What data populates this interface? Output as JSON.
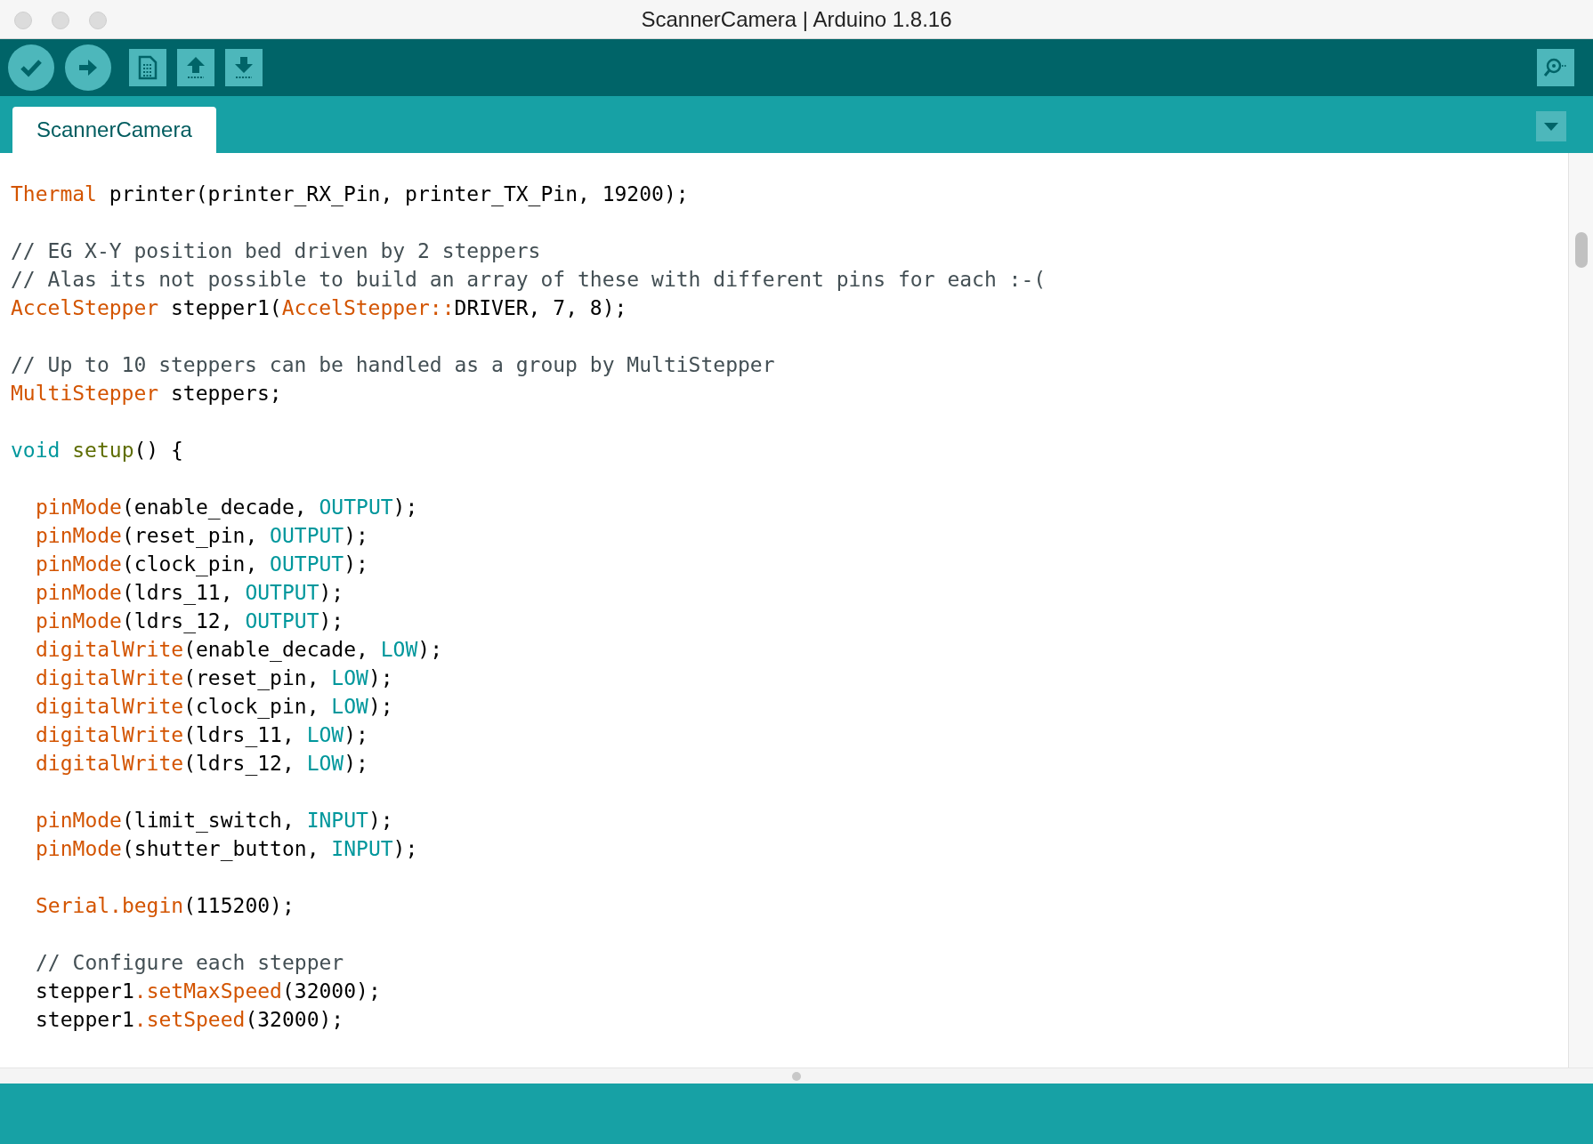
{
  "window": {
    "title": "ScannerCamera | Arduino 1.8.16"
  },
  "toolbar": {
    "buttons": [
      {
        "kind": "verify"
      },
      {
        "kind": "upload"
      },
      {
        "kind": "new"
      },
      {
        "kind": "open"
      },
      {
        "kind": "save"
      }
    ],
    "right_button": {
      "kind": "serial"
    }
  },
  "tabs": [
    {
      "label": "ScannerCamera",
      "selected": true
    }
  ],
  "editor": {
    "blocks": [
      {
        "lines": [
          {
            "tokens": [
              {
                "t": "Thermal",
                "kind": "type"
              },
              {
                "t": " printer(printer_RX_Pin, printer_TX_Pin, 19200);",
                "kind": "plain"
              }
            ]
          }
        ]
      },
      {
        "lines": [
          {
            "tokens": [
              {
                "t": "// EG X-Y position bed driven by 2 steppers",
                "kind": "comment"
              }
            ]
          },
          {
            "tokens": [
              {
                "t": "// Alas its not possible to build an array of these with different pins for each :-(",
                "kind": "comment"
              }
            ]
          },
          {
            "tokens": [
              {
                "t": "AccelStepper",
                "kind": "type"
              },
              {
                "t": " stepper1(",
                "kind": "plain"
              },
              {
                "t": "AccelStepper::",
                "kind": "type"
              },
              {
                "t": "DRIVER, 7, 8);",
                "kind": "plain"
              }
            ]
          }
        ]
      },
      {
        "lines": [
          {
            "tokens": [
              {
                "t": "// Up to 10 steppers can be handled as a group by MultiStepper",
                "kind": "comment"
              }
            ]
          },
          {
            "tokens": [
              {
                "t": "MultiStepper",
                "kind": "type"
              },
              {
                "t": " steppers;",
                "kind": "plain"
              }
            ]
          }
        ]
      },
      {
        "lines": [
          {
            "tokens": [
              {
                "t": "void",
                "kind": "keyword"
              },
              {
                "t": " setup",
                "kind": "decl"
              },
              {
                "t": "() {",
                "kind": "plain"
              }
            ],
            "children": [
              {
                "lines": [
                  {
                    "tokens": [
                      {
                        "t": "pinMode",
                        "kind": "type"
                      },
                      {
                        "t": "(enable_decade, ",
                        "kind": "plain"
                      },
                      {
                        "t": "OUTPUT",
                        "kind": "keyword"
                      },
                      {
                        "t": ");",
                        "kind": "plain"
                      }
                    ]
                  },
                  {
                    "tokens": [
                      {
                        "t": "pinMode",
                        "kind": "type"
                      },
                      {
                        "t": "(reset_pin, ",
                        "kind": "plain"
                      },
                      {
                        "t": "OUTPUT",
                        "kind": "keyword"
                      },
                      {
                        "t": ");",
                        "kind": "plain"
                      }
                    ]
                  },
                  {
                    "tokens": [
                      {
                        "t": "pinMode",
                        "kind": "type"
                      },
                      {
                        "t": "(clock_pin, ",
                        "kind": "plain"
                      },
                      {
                        "t": "OUTPUT",
                        "kind": "keyword"
                      },
                      {
                        "t": ");",
                        "kind": "plain"
                      }
                    ]
                  },
                  {
                    "tokens": [
                      {
                        "t": "pinMode",
                        "kind": "type"
                      },
                      {
                        "t": "(ldrs_11, ",
                        "kind": "plain"
                      },
                      {
                        "t": "OUTPUT",
                        "kind": "keyword"
                      },
                      {
                        "t": ");",
                        "kind": "plain"
                      }
                    ]
                  },
                  {
                    "tokens": [
                      {
                        "t": "pinMode",
                        "kind": "type"
                      },
                      {
                        "t": "(ldrs_12, ",
                        "kind": "plain"
                      },
                      {
                        "t": "OUTPUT",
                        "kind": "keyword"
                      },
                      {
                        "t": ");",
                        "kind": "plain"
                      }
                    ]
                  },
                  {
                    "tokens": [
                      {
                        "t": "digitalWrite",
                        "kind": "type"
                      },
                      {
                        "t": "(enable_decade, ",
                        "kind": "plain"
                      },
                      {
                        "t": "LOW",
                        "kind": "keyword"
                      },
                      {
                        "t": ");",
                        "kind": "plain"
                      }
                    ]
                  },
                  {
                    "tokens": [
                      {
                        "t": "digitalWrite",
                        "kind": "type"
                      },
                      {
                        "t": "(reset_pin, ",
                        "kind": "plain"
                      },
                      {
                        "t": "LOW",
                        "kind": "keyword"
                      },
                      {
                        "t": ");",
                        "kind": "plain"
                      }
                    ]
                  },
                  {
                    "tokens": [
                      {
                        "t": "digitalWrite",
                        "kind": "type"
                      },
                      {
                        "t": "(clock_pin, ",
                        "kind": "plain"
                      },
                      {
                        "t": "LOW",
                        "kind": "keyword"
                      },
                      {
                        "t": ");",
                        "kind": "plain"
                      }
                    ]
                  },
                  {
                    "tokens": [
                      {
                        "t": "digitalWrite",
                        "kind": "type"
                      },
                      {
                        "t": "(ldrs_11, ",
                        "kind": "plain"
                      },
                      {
                        "t": "LOW",
                        "kind": "keyword"
                      },
                      {
                        "t": ");",
                        "kind": "plain"
                      }
                    ]
                  },
                  {
                    "tokens": [
                      {
                        "t": "digitalWrite",
                        "kind": "type"
                      },
                      {
                        "t": "(ldrs_12, ",
                        "kind": "plain"
                      },
                      {
                        "t": "LOW",
                        "kind": "keyword"
                      },
                      {
                        "t": ");",
                        "kind": "plain"
                      }
                    ]
                  }
                ]
              },
              {
                "lines": [
                  {
                    "tokens": [
                      {
                        "t": "pinMode",
                        "kind": "type"
                      },
                      {
                        "t": "(limit_switch, ",
                        "kind": "plain"
                      },
                      {
                        "t": "INPUT",
                        "kind": "keyword"
                      },
                      {
                        "t": ");",
                        "kind": "plain"
                      }
                    ]
                  },
                  {
                    "tokens": [
                      {
                        "t": "pinMode",
                        "kind": "type"
                      },
                      {
                        "t": "(shutter_button, ",
                        "kind": "plain"
                      },
                      {
                        "t": "INPUT",
                        "kind": "keyword"
                      },
                      {
                        "t": ");",
                        "kind": "plain"
                      }
                    ]
                  }
                ]
              },
              {
                "lines": [
                  {
                    "tokens": [
                      {
                        "t": "Serial.begin",
                        "kind": "type"
                      },
                      {
                        "t": "(115200);",
                        "kind": "plain"
                      }
                    ]
                  }
                ]
              },
              {
                "lines": [
                  {
                    "tokens": [
                      {
                        "t": "// Configure each stepper",
                        "kind": "comment"
                      }
                    ]
                  },
                  {
                    "tokens": [
                      {
                        "t": "stepper1",
                        "kind": "plain"
                      },
                      {
                        "t": ".setMaxSpeed",
                        "kind": "type"
                      },
                      {
                        "t": "(32000);",
                        "kind": "plain"
                      }
                    ]
                  },
                  {
                    "tokens": [
                      {
                        "t": "stepper1",
                        "kind": "plain"
                      },
                      {
                        "t": ".setSpeed",
                        "kind": "type"
                      },
                      {
                        "t": "(32000);",
                        "kind": "plain"
                      }
                    ]
                  }
                ]
              }
            ]
          }
        ]
      }
    ]
  }
}
